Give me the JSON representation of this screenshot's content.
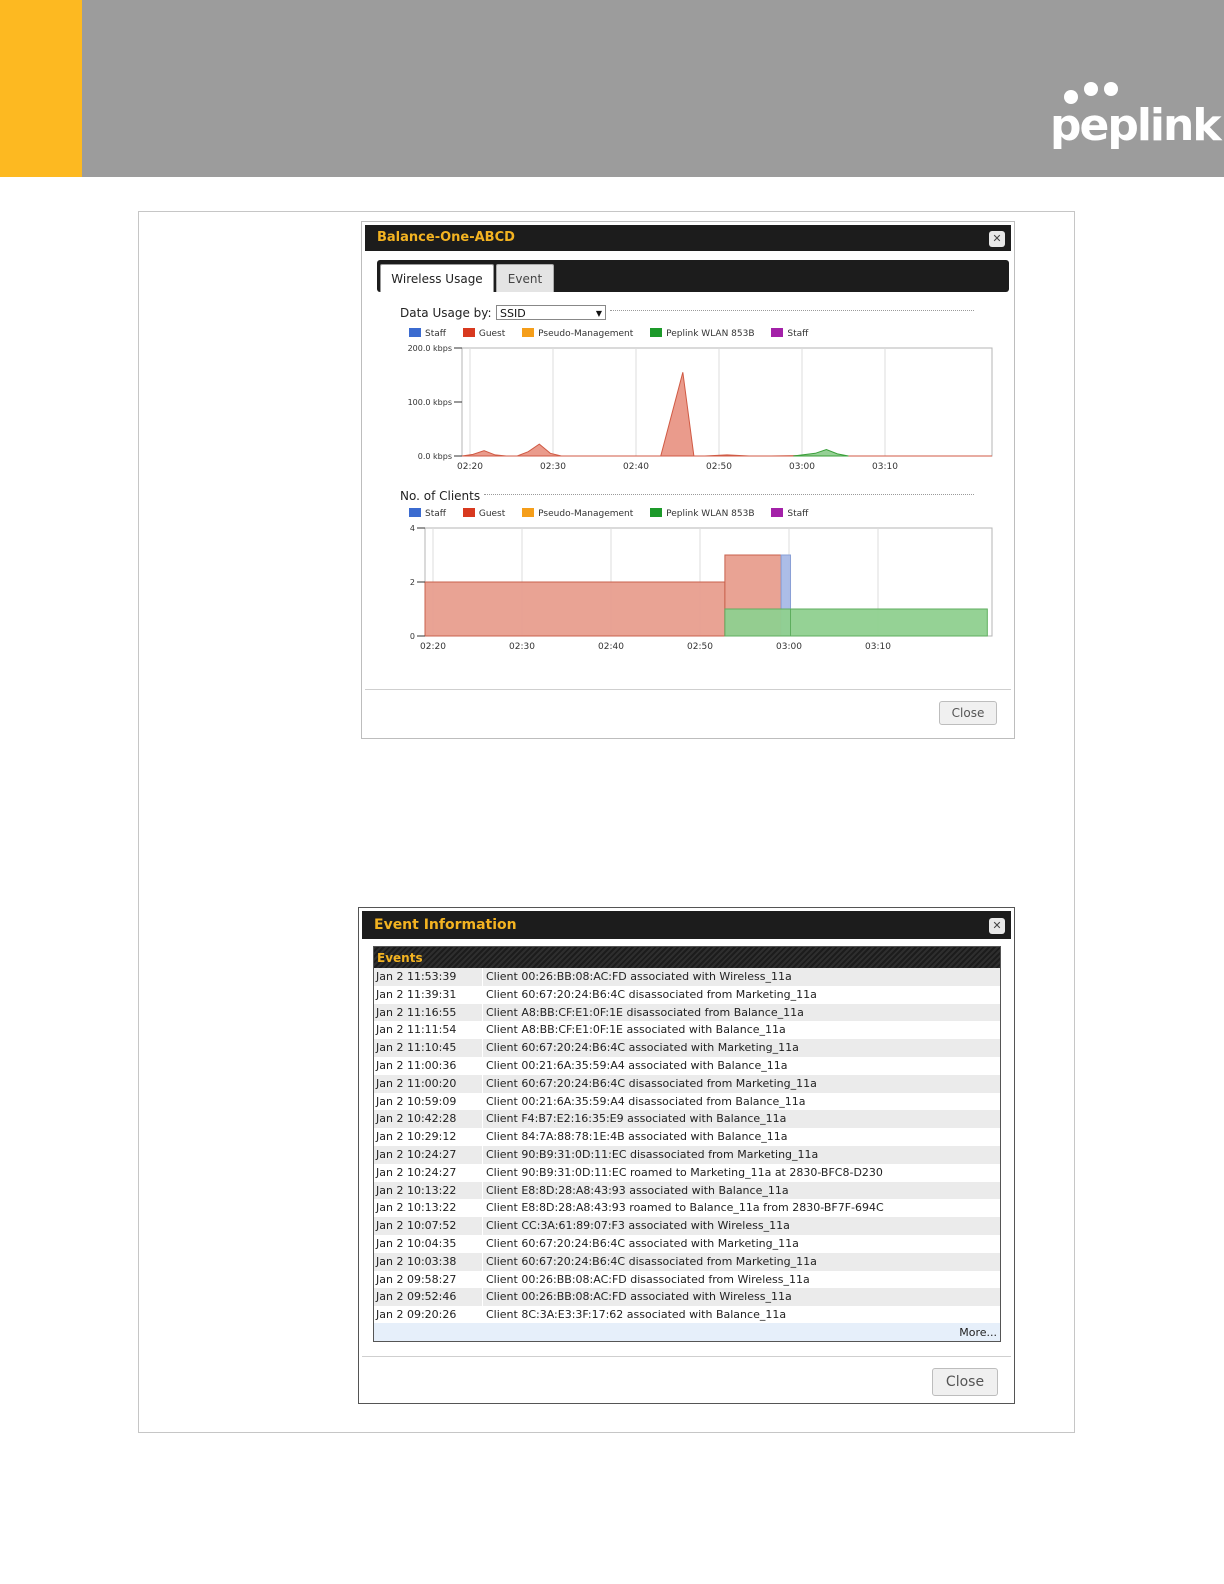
{
  "brand": {
    "logo_text": "peplink",
    "colors": {
      "yellow": "#fdb921",
      "gray": "#9c9c9c"
    }
  },
  "usage_dialog": {
    "title": "Balance-One-ABCD",
    "close_icon": "close-icon",
    "tabs": [
      {
        "label": "Wireless Usage",
        "active": true
      },
      {
        "label": "Event",
        "active": false
      }
    ],
    "data_usage": {
      "label": "Data Usage by:",
      "select_value": "SSID",
      "legend": [
        {
          "name": "Staff",
          "color": "#3b6bd0"
        },
        {
          "name": "Guest",
          "color": "#d8391f"
        },
        {
          "name": "Pseudo-Management",
          "color": "#f59e1a"
        },
        {
          "name": "Peplink WLAN 853B",
          "color": "#1d9a2a"
        },
        {
          "name": "Staff",
          "color": "#a321a8"
        }
      ]
    },
    "clients": {
      "label": "No. of Clients",
      "legend": [
        {
          "name": "Staff",
          "color": "#3b6bd0"
        },
        {
          "name": "Guest",
          "color": "#d8391f"
        },
        {
          "name": "Pseudo-Management",
          "color": "#f59e1a"
        },
        {
          "name": "Peplink WLAN 853B",
          "color": "#1d9a2a"
        },
        {
          "name": "Staff",
          "color": "#a321a8"
        }
      ]
    },
    "close_label": "Close"
  },
  "chart_data": [
    {
      "type": "area",
      "title": "",
      "xlabel": "",
      "ylabel": "",
      "x_ticks": [
        "02:20",
        "02:30",
        "02:40",
        "02:50",
        "03:00",
        "03:10"
      ],
      "y_ticks": [
        "0.0 kbps",
        "100.0 kbps",
        "200.0 kbps"
      ],
      "ylim": [
        0,
        200
      ],
      "grid": true,
      "series": [
        {
          "name": "Guest",
          "color": "#e8907f",
          "points": [
            [
              0,
              0
            ],
            [
              1,
              3
            ],
            [
              2,
              10
            ],
            [
              3,
              2
            ],
            [
              4,
              0
            ],
            [
              5,
              0
            ],
            [
              6,
              8
            ],
            [
              7,
              22
            ],
            [
              8,
              5
            ],
            [
              9,
              0
            ],
            [
              12,
              0
            ],
            [
              15,
              0
            ],
            [
              17,
              0
            ],
            [
              18,
              0
            ],
            [
              20,
              155
            ],
            [
              21,
              0
            ],
            [
              22,
              0
            ],
            [
              24,
              2
            ],
            [
              26,
              0
            ],
            [
              28,
              0
            ],
            [
              31,
              1
            ],
            [
              33,
              0
            ],
            [
              35,
              0
            ],
            [
              38,
              0
            ],
            [
              40,
              0
            ],
            [
              42,
              0
            ],
            [
              44,
              0
            ],
            [
              46,
              0
            ],
            [
              48,
              0
            ]
          ]
        },
        {
          "name": "Peplink WLAN 853B",
          "color": "#8acb8a",
          "points": [
            [
              30,
              0
            ],
            [
              32,
              5
            ],
            [
              33,
              12
            ],
            [
              34,
              4
            ],
            [
              35,
              0
            ]
          ]
        }
      ]
    },
    {
      "type": "area",
      "title": "",
      "xlabel": "",
      "ylabel": "",
      "x_ticks": [
        "02:20",
        "02:30",
        "02:40",
        "02:50",
        "03:00",
        "03:10"
      ],
      "y_ticks": [
        "0",
        "2",
        "4"
      ],
      "ylim": [
        0,
        4
      ],
      "grid": true,
      "series": [
        {
          "name": "Guest",
          "color": "#e89e8e",
          "steps": [
            [
              0,
              32,
              2
            ],
            [
              32,
              38,
              3
            ],
            [
              38,
              39,
              1
            ]
          ]
        },
        {
          "name": "Staff",
          "color": "#a8b9e6",
          "steps": [
            [
              38,
              39,
              3
            ]
          ]
        },
        {
          "name": "Peplink WLAN 853B",
          "color": "#8fd08f",
          "steps": [
            [
              32,
              39,
              1
            ],
            [
              39,
              60,
              1
            ]
          ]
        }
      ]
    }
  ],
  "event_dialog": {
    "title": "Event Information",
    "close_icon": "close-icon",
    "events_header": "Events",
    "events": [
      {
        "time": "Jan 2 11:53:39",
        "message": "Client 00:26:BB:08:AC:FD associated with Wireless_11a"
      },
      {
        "time": "Jan 2 11:39:31",
        "message": "Client 60:67:20:24:B6:4C disassociated from Marketing_11a"
      },
      {
        "time": "Jan 2 11:16:55",
        "message": "Client A8:BB:CF:E1:0F:1E disassociated from Balance_11a"
      },
      {
        "time": "Jan 2 11:11:54",
        "message": "Client A8:BB:CF:E1:0F:1E associated with Balance_11a"
      },
      {
        "time": "Jan 2 11:10:45",
        "message": "Client 60:67:20:24:B6:4C associated with Marketing_11a"
      },
      {
        "time": "Jan 2 11:00:36",
        "message": "Client 00:21:6A:35:59:A4 associated with Balance_11a"
      },
      {
        "time": "Jan 2 11:00:20",
        "message": "Client 60:67:20:24:B6:4C disassociated from Marketing_11a"
      },
      {
        "time": "Jan 2 10:59:09",
        "message": "Client 00:21:6A:35:59:A4 disassociated from Balance_11a"
      },
      {
        "time": "Jan 2 10:42:28",
        "message": "Client F4:B7:E2:16:35:E9 associated with Balance_11a"
      },
      {
        "time": "Jan 2 10:29:12",
        "message": "Client 84:7A:88:78:1E:4B associated with Balance_11a"
      },
      {
        "time": "Jan 2 10:24:27",
        "message": "Client 90:B9:31:0D:11:EC disassociated from Marketing_11a"
      },
      {
        "time": "Jan 2 10:24:27",
        "message": "Client 90:B9:31:0D:11:EC roamed to Marketing_11a at 2830-BFC8-D230"
      },
      {
        "time": "Jan 2 10:13:22",
        "message": "Client E8:8D:28:A8:43:93 associated with Balance_11a"
      },
      {
        "time": "Jan 2 10:13:22",
        "message": "Client E8:8D:28:A8:43:93 roamed to Balance_11a from 2830-BF7F-694C"
      },
      {
        "time": "Jan 2 10:07:52",
        "message": "Client CC:3A:61:89:07:F3 associated with Wireless_11a"
      },
      {
        "time": "Jan 2 10:04:35",
        "message": "Client 60:67:20:24:B6:4C associated with Marketing_11a"
      },
      {
        "time": "Jan 2 10:03:38",
        "message": "Client 60:67:20:24:B6:4C disassociated from Marketing_11a"
      },
      {
        "time": "Jan 2 09:58:27",
        "message": "Client 00:26:BB:08:AC:FD disassociated from Wireless_11a"
      },
      {
        "time": "Jan 2 09:52:46",
        "message": "Client 00:26:BB:08:AC:FD associated with Wireless_11a"
      },
      {
        "time": "Jan 2 09:20:26",
        "message": "Client 8C:3A:E3:3F:17:62 associated with Balance_11a"
      }
    ],
    "more_label": "More...",
    "close_label": "Close"
  }
}
